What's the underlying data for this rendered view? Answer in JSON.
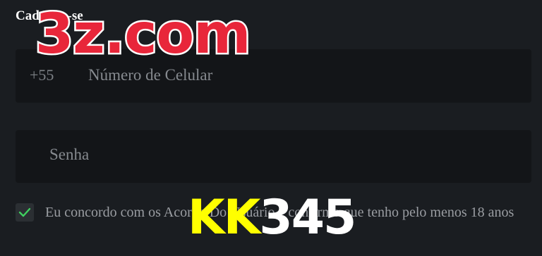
{
  "form": {
    "title": "Cadastre-se",
    "phone": {
      "prefix": "+55",
      "placeholder": "Número de Celular"
    },
    "password": {
      "placeholder": "Senha"
    },
    "agreement": {
      "checked": true,
      "text": "Eu concordo com os Acordo Do Usuário e confirmo que tenho pelo menos 18 anos"
    }
  },
  "watermarks": {
    "top": "3z.com",
    "bottom_yellow": "KK",
    "bottom_white": "345"
  },
  "colors": {
    "background": "#1a1d21",
    "field": "#131518",
    "check": "#3fcf5f",
    "watermark_red": "#e8263a",
    "watermark_yellow": "#ffff00"
  },
  "icons": {
    "checkbox": "check-icon"
  }
}
